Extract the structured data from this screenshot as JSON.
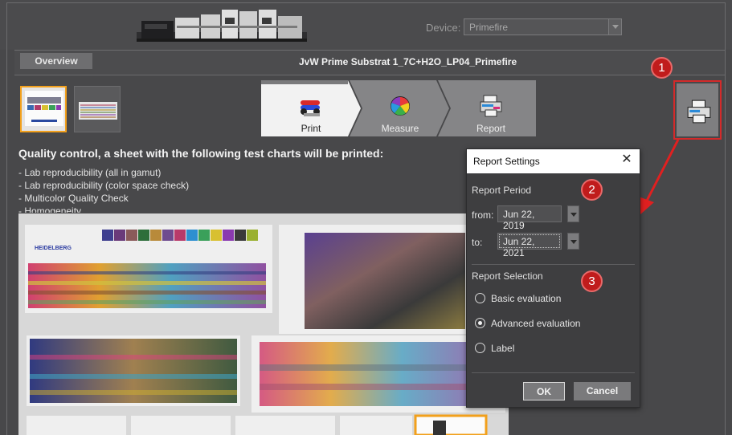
{
  "header": {
    "device_label": "Device:",
    "device_value": "Primefire"
  },
  "titlebar": {
    "overview_label": "Overview",
    "job_title": "JvW Prime Substrat 1_7C+H2O_LP04_Primefire"
  },
  "steps": [
    {
      "label": "Print",
      "icon": "print-rollers-icon",
      "active": true
    },
    {
      "label": "Measure",
      "icon": "color-wheel-icon",
      "active": false
    },
    {
      "label": "Report",
      "icon": "report-printer-icon",
      "active": false
    }
  ],
  "print_report_button": {
    "icon": "print-report-icon"
  },
  "annotations": [
    "1",
    "2",
    "3"
  ],
  "qc": {
    "title": "Quality control, a sheet with the following test charts will be printed:",
    "items": [
      "- Lab reproducibility (all in gamut)",
      "- Lab reproducibility (color space check)",
      "- Multicolor Quality Check",
      "- Homogeneity"
    ]
  },
  "chart_preview": {
    "brand_text": "HEIDELBERG",
    "swatch_colors": [
      "#3f3f8f",
      "#6a3a7a",
      "#8a5a5a",
      "#2e6e3a",
      "#b88a3a",
      "#6f4b8f",
      "#b83a6a",
      "#2e8fd0",
      "#3aa05a",
      "#d8c030",
      "#8a3ab0",
      "#3a3a3a",
      "#9ab030"
    ]
  },
  "dialog": {
    "title": "Report Settings",
    "close_icon": "close-icon",
    "period_label": "Report Period",
    "from_label": "from:",
    "from_value": "Jun 22, 2019",
    "to_label": "to:",
    "to_value": "Jun 22, 2021",
    "selection_label": "Report Selection",
    "options": [
      {
        "label": "Basic evaluation",
        "checked": false
      },
      {
        "label": "Advanced evaluation",
        "checked": true
      },
      {
        "label": "Label",
        "checked": false
      }
    ],
    "ok_label": "OK",
    "cancel_label": "Cancel"
  },
  "colors": {
    "highlight_red": "#d42a2a",
    "selection_orange": "#f2a01c"
  }
}
